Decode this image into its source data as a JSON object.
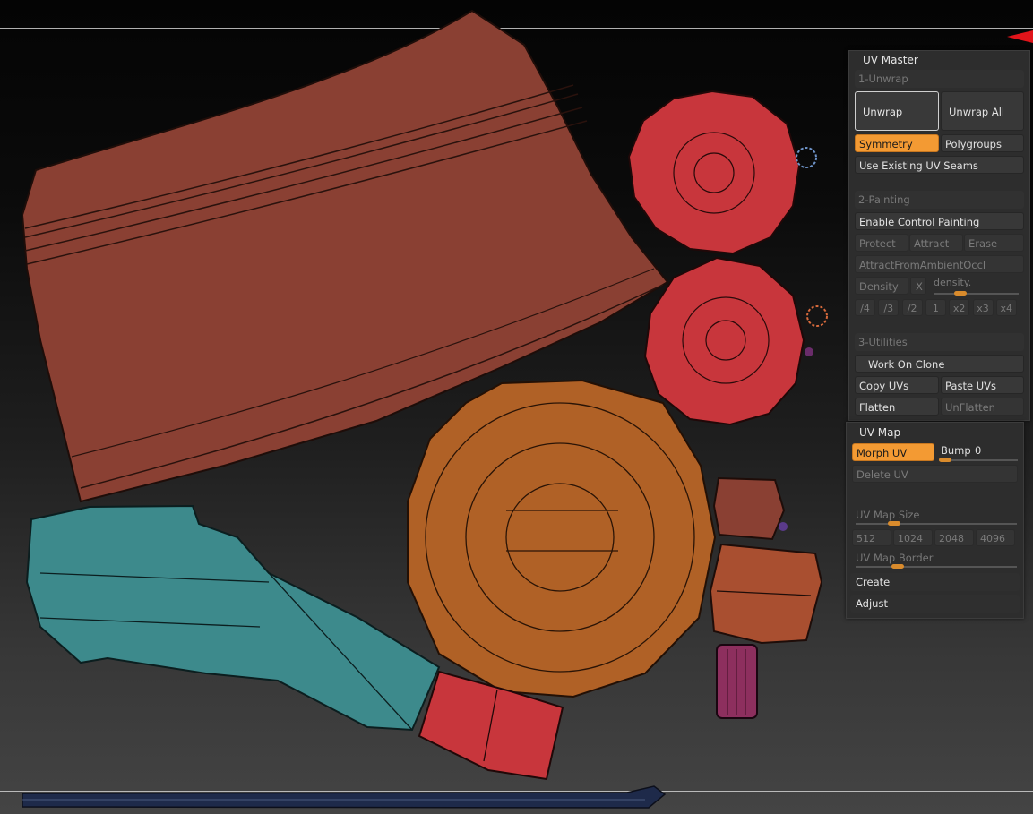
{
  "uv_master": {
    "title": "UV Master",
    "unwrap_header": "1-Unwrap",
    "unwrap": "Unwrap",
    "unwrap_all": "Unwrap All",
    "symmetry": "Symmetry",
    "polygroups": "Polygroups",
    "use_existing_seams": "Use Existing UV Seams",
    "painting_header": "2-Painting",
    "enable_control_painting": "Enable Control Painting",
    "protect": "Protect",
    "attract": "Attract",
    "erase": "Erase",
    "attract_from_ao": "AttractFromAmbientOccl",
    "density": "Density",
    "density_x": "X",
    "density_slider_label": "density.",
    "density_buttons": [
      "/4",
      "/3",
      "/2",
      "1",
      "x2",
      "x3",
      "x4"
    ],
    "utilities_header": "3-Utilities",
    "work_on_clone": "Work On Clone",
    "copy_uvs": "Copy UVs",
    "paste_uvs": "Paste UVs",
    "flatten": "Flatten",
    "unflatten": "UnFlatten"
  },
  "uv_map": {
    "title": "UV Map",
    "morph_uv": "Morph UV",
    "bump_label": "Bump",
    "bump_value": "0",
    "delete_uv": "Delete UV",
    "map_size_label": "UV Map Size",
    "sizes": [
      "512",
      "1024",
      "2048",
      "4096"
    ],
    "map_border_label": "UV Map Border",
    "create": "Create",
    "adjust": "Adjust"
  },
  "colors": {
    "accent": "#f39a33",
    "panel_bg": "#2d2d2d",
    "uv_brown": "#8a4033",
    "uv_red": "#c8363c",
    "uv_orange": "#b06126",
    "uv_teal": "#3d8a8c",
    "uv_magenta": "#8d2f5e"
  }
}
